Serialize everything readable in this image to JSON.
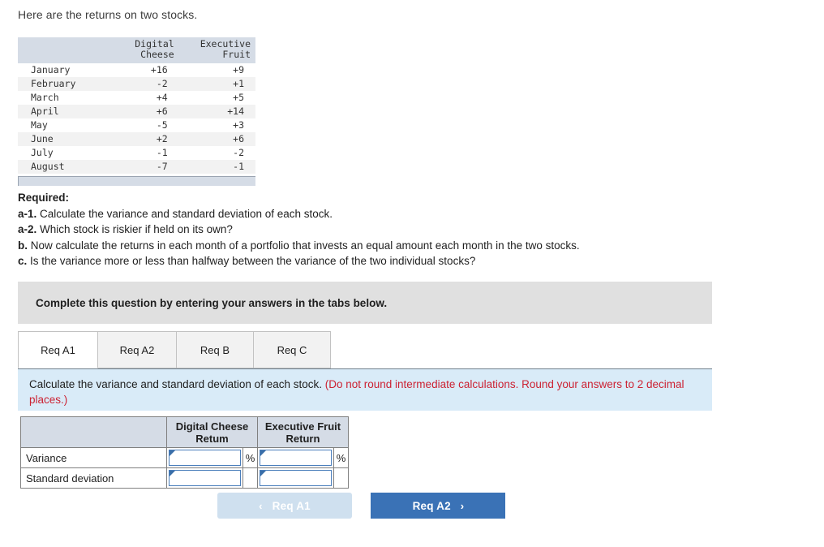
{
  "intro": "Here are the returns on two stocks.",
  "returns_table": {
    "col_blank": "",
    "col_digital": "Digital\nCheese",
    "col_executive": "Executive\nFruit",
    "rows": [
      {
        "month": "January",
        "digital": "+16",
        "executive": "+9"
      },
      {
        "month": "February",
        "digital": "-2",
        "executive": "+1"
      },
      {
        "month": "March",
        "digital": "+4",
        "executive": "+5"
      },
      {
        "month": "April",
        "digital": "+6",
        "executive": "+14"
      },
      {
        "month": "May",
        "digital": "-5",
        "executive": "+3"
      },
      {
        "month": "June",
        "digital": "+2",
        "executive": "+6"
      },
      {
        "month": "July",
        "digital": "-1",
        "executive": "-2"
      },
      {
        "month": "August",
        "digital": "-7",
        "executive": "-1"
      }
    ]
  },
  "required": {
    "heading": "Required:",
    "items": [
      {
        "label": "a-1.",
        "text": "Calculate the variance and standard deviation of each stock."
      },
      {
        "label": "a-2.",
        "text": "Which stock is riskier if held on its own?"
      },
      {
        "label": "b.",
        "text": "Now calculate the returns in each month of a portfolio that invests an equal amount each month in the two stocks."
      },
      {
        "label": "c.",
        "text": "Is the variance more or less than halfway between the variance of the two individual stocks?"
      }
    ]
  },
  "banner": "Complete this question by entering your answers in the tabs below.",
  "tabs": [
    {
      "label": "Req A1",
      "active": true
    },
    {
      "label": "Req A2",
      "active": false
    },
    {
      "label": "Req B",
      "active": false
    },
    {
      "label": "Req C",
      "active": false
    }
  ],
  "question_panel": {
    "text": "Calculate the variance and standard deviation of each stock.",
    "note": "(Do not round intermediate calculations. Round your answers to 2 decimal places.)"
  },
  "answer_table": {
    "header_blank": "",
    "header_digital": "Digital Cheese\nRetum",
    "header_executive": "Executive Fruit\nReturn",
    "rows": [
      {
        "label": "Variance",
        "digital_value": "",
        "digital_unit": "%",
        "executive_value": "",
        "executive_unit": "%"
      },
      {
        "label": "Standard deviation",
        "digital_value": "",
        "digital_unit": "",
        "executive_value": "",
        "executive_unit": ""
      }
    ]
  },
  "nav": {
    "prev_label": "Req A1",
    "prev_chevron": "‹",
    "next_label": "Req A2",
    "next_chevron": "›"
  },
  "colors": {
    "table_header": "#d5dce6",
    "banner_grey": "#e0e0e0",
    "panel_blue": "#d9ebf8",
    "note_red": "#cc2233",
    "button_blue": "#3a72b6",
    "button_disabled": "#cfe0ef",
    "input_border": "#4a7ebb"
  }
}
